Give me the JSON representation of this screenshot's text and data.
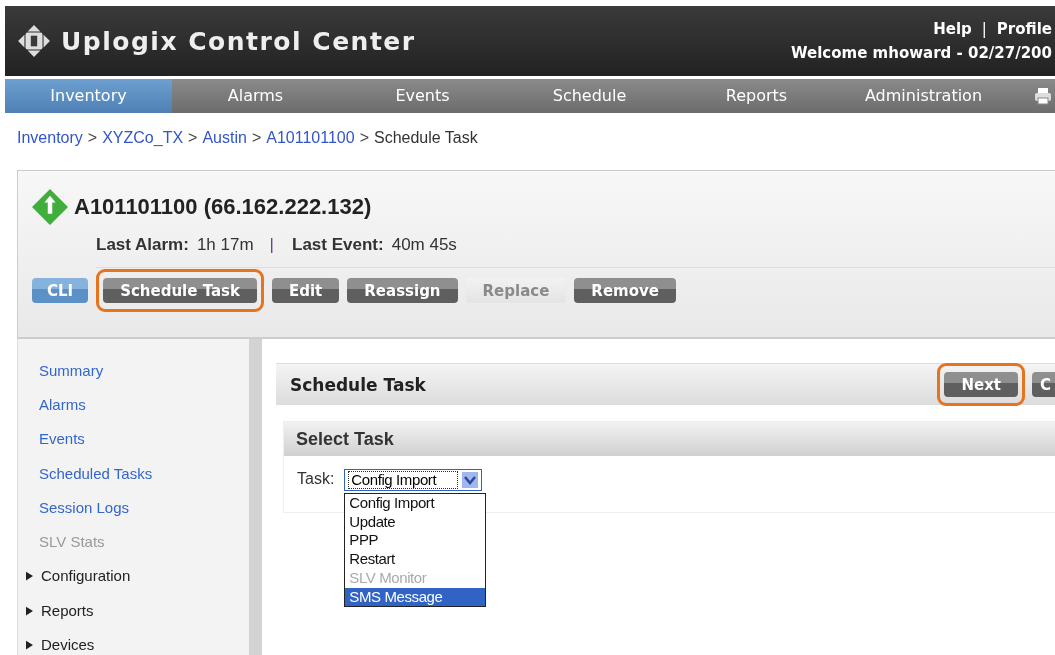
{
  "header": {
    "title": "Uplogix Control Center",
    "links": [
      "Help",
      "Profile"
    ],
    "separator": "|",
    "welcome": "Welcome mhoward - 02/27/200"
  },
  "nav": {
    "tabs": [
      {
        "label": "Inventory",
        "selected": true
      },
      {
        "label": "Alarms",
        "selected": false
      },
      {
        "label": "Events",
        "selected": false
      },
      {
        "label": "Schedule",
        "selected": false
      },
      {
        "label": "Reports",
        "selected": false
      },
      {
        "label": "Administration",
        "selected": false
      }
    ]
  },
  "breadcrumb": {
    "separator": ">",
    "items": [
      {
        "label": "Inventory",
        "link": true
      },
      {
        "label": "XYZCo_TX",
        "link": true
      },
      {
        "label": "Austin",
        "link": true
      },
      {
        "label": "A101101100",
        "link": true
      },
      {
        "label": "Schedule Task",
        "link": false
      }
    ]
  },
  "device": {
    "title": "A101101100 (66.162.222.132)",
    "last_alarm": {
      "label": "Last Alarm:",
      "value": "1h 17m"
    },
    "separator": "|",
    "last_event": {
      "label": "Last Event:",
      "value": "40m 45s"
    },
    "buttons": [
      {
        "label": "CLI",
        "kind": "primary",
        "disabled": false,
        "highlighted": false
      },
      {
        "label": "Schedule Task",
        "kind": "normal",
        "disabled": false,
        "highlighted": true
      },
      {
        "label": "Edit",
        "kind": "normal",
        "disabled": false,
        "highlighted": false
      },
      {
        "label": "Reassign",
        "kind": "normal",
        "disabled": false,
        "highlighted": false
      },
      {
        "label": "Replace",
        "kind": "normal",
        "disabled": true,
        "highlighted": false
      },
      {
        "label": "Remove",
        "kind": "normal",
        "disabled": false,
        "highlighted": false
      }
    ]
  },
  "sidebar": {
    "items": [
      {
        "label": "Summary",
        "kind": "link",
        "disabled": false
      },
      {
        "label": "Alarms",
        "kind": "link",
        "disabled": false
      },
      {
        "label": "Events",
        "kind": "link",
        "disabled": false
      },
      {
        "label": "Scheduled Tasks",
        "kind": "link",
        "disabled": false
      },
      {
        "label": "Session Logs",
        "kind": "link",
        "disabled": false
      },
      {
        "label": "SLV Stats",
        "kind": "link",
        "disabled": true
      },
      {
        "label": "Configuration",
        "kind": "section",
        "expanded": false
      },
      {
        "label": "Reports",
        "kind": "section",
        "expanded": false
      },
      {
        "label": "Devices",
        "kind": "section",
        "expanded": false
      }
    ]
  },
  "panel": {
    "title": "Schedule Task",
    "buttons": [
      {
        "label": "Next",
        "highlighted": true
      },
      {
        "label": "C",
        "highlighted": false
      }
    ],
    "section": {
      "title": "Select Task",
      "field": {
        "label": "Task:",
        "value": "Config Import",
        "expanded": true,
        "options": [
          {
            "label": "Config Import",
            "disabled": false,
            "hovered": false
          },
          {
            "label": "Update",
            "disabled": false,
            "hovered": false
          },
          {
            "label": "PPP",
            "disabled": false,
            "hovered": false
          },
          {
            "label": "Restart",
            "disabled": false,
            "hovered": false
          },
          {
            "label": "SLV Monitor",
            "disabled": true,
            "hovered": false
          },
          {
            "label": "SMS Message",
            "disabled": false,
            "hovered": true
          }
        ]
      }
    }
  }
}
